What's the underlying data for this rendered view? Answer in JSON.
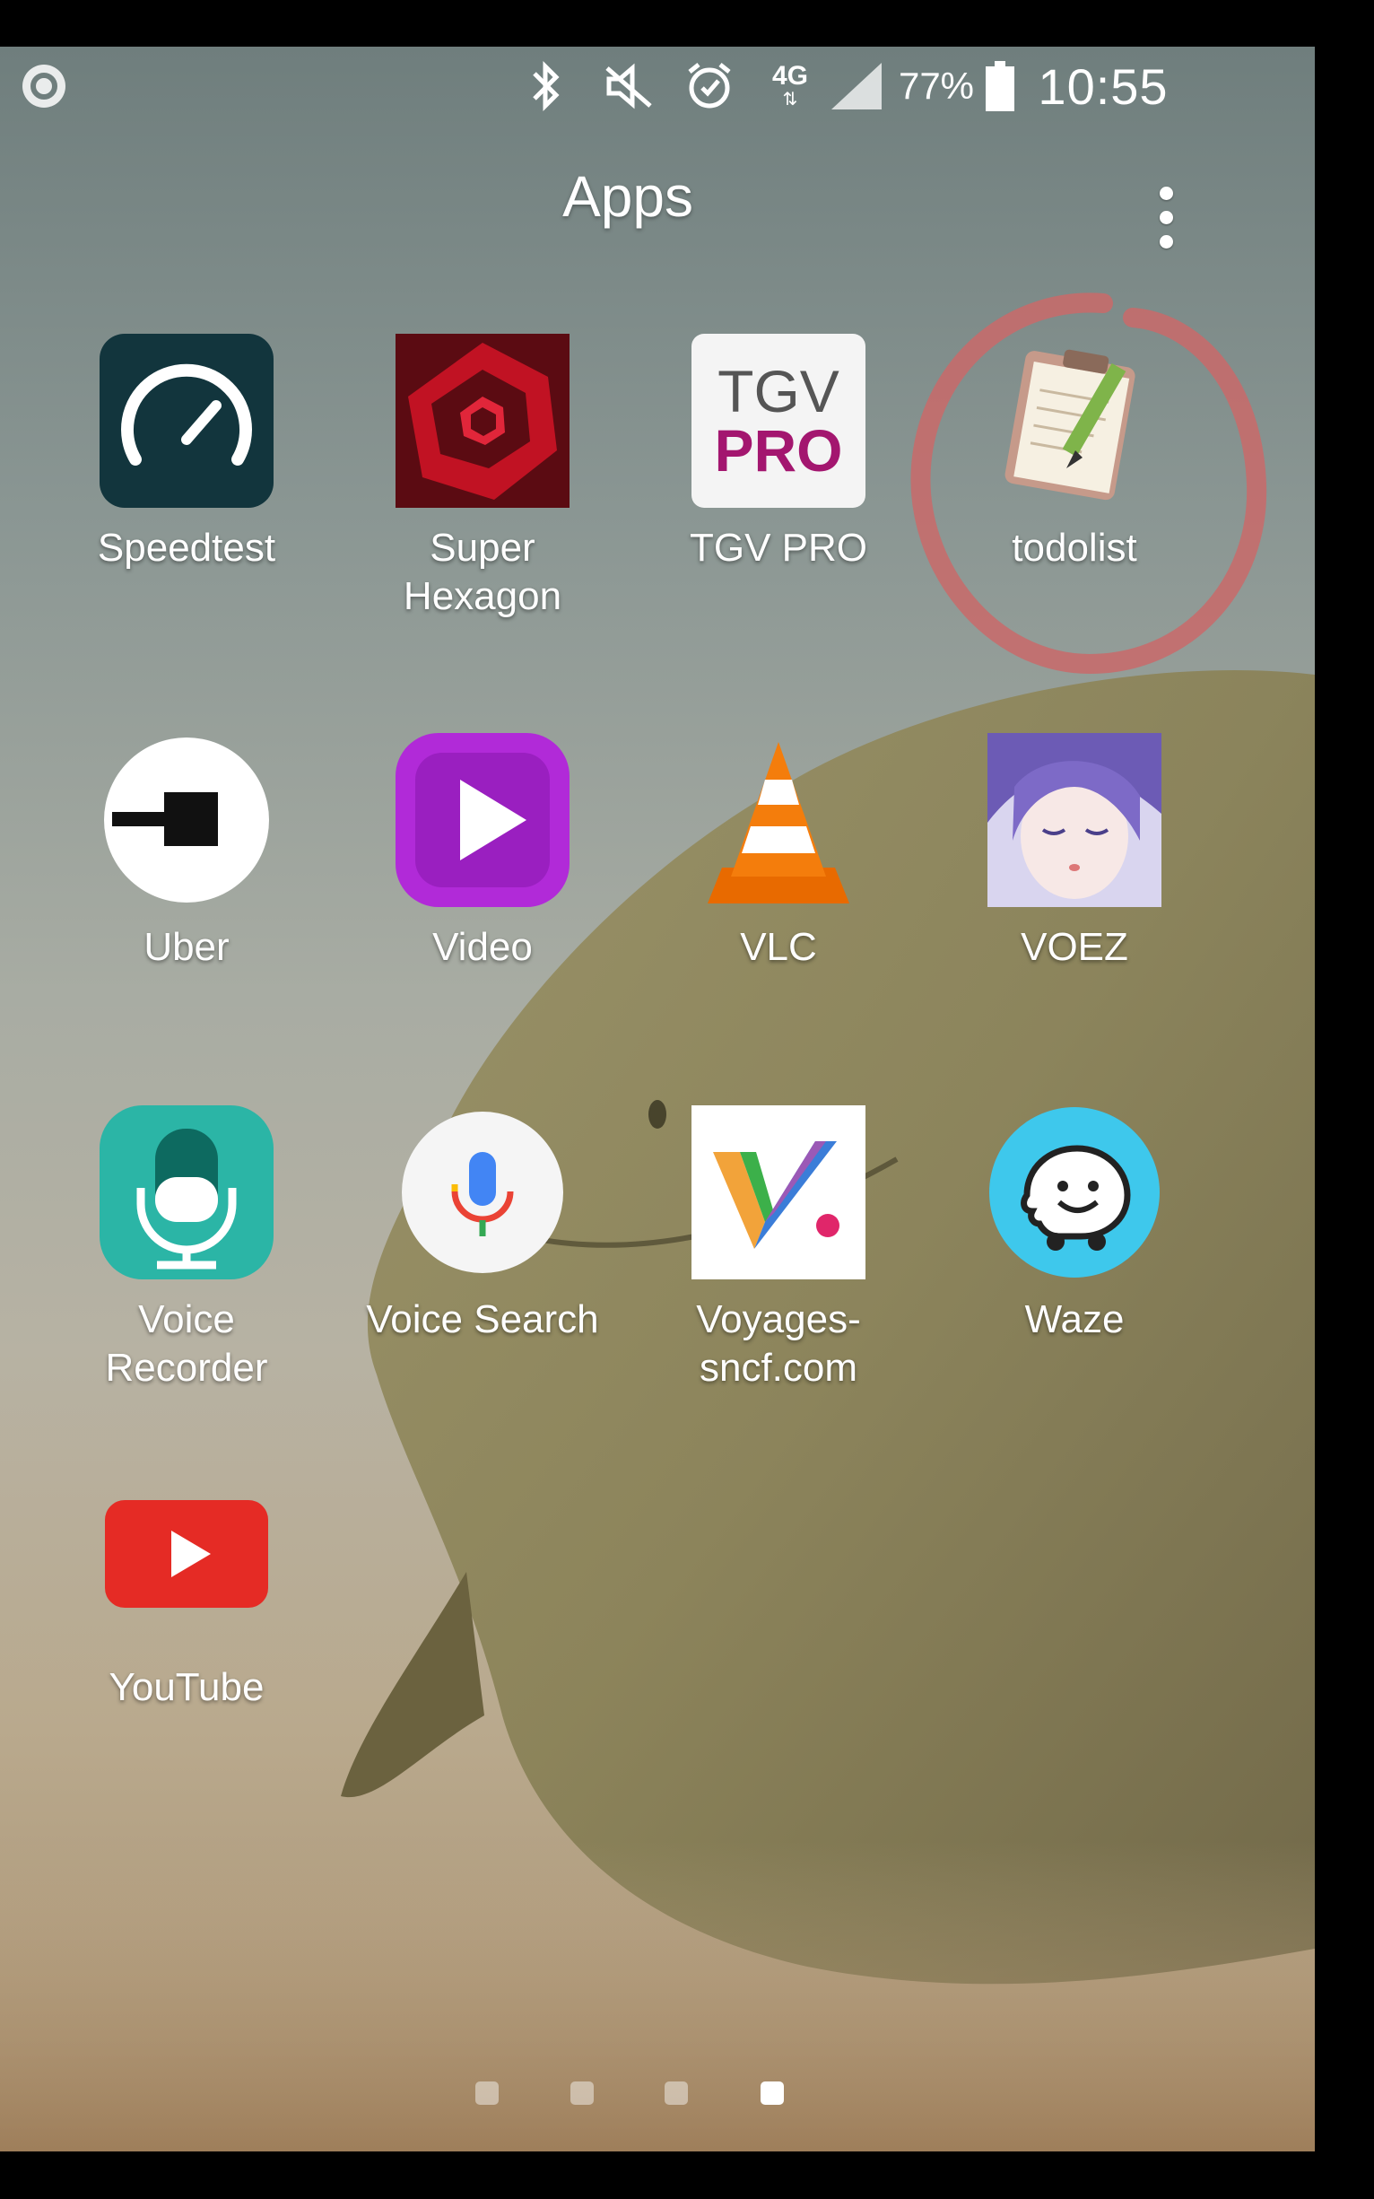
{
  "status_bar": {
    "time": "10:55",
    "battery_percent": "77%",
    "network": "4G",
    "icons": [
      "app-notification-icon",
      "bluetooth-icon",
      "mute-icon",
      "alarm-icon",
      "signal-icon",
      "battery-icon"
    ]
  },
  "header": {
    "title": "Apps",
    "more_icon": "more-vertical-icon"
  },
  "apps": [
    {
      "label": "Speedtest",
      "icon": "speedtest-icon"
    },
    {
      "label": "Super\nHexagon",
      "icon": "super-hexagon-icon"
    },
    {
      "label": "TGV PRO",
      "icon": "tgv-pro-icon",
      "icon_text_top": "TGV",
      "icon_text_bottom": "PRO"
    },
    {
      "label": "todolist",
      "icon": "todolist-icon",
      "highlighted": true
    },
    {
      "label": "Uber",
      "icon": "uber-icon"
    },
    {
      "label": "Video",
      "icon": "video-icon"
    },
    {
      "label": "VLC",
      "icon": "vlc-icon"
    },
    {
      "label": "VOEZ",
      "icon": "voez-icon"
    },
    {
      "label": "Voice\nRecorder",
      "icon": "voice-recorder-icon"
    },
    {
      "label": "Voice Search",
      "icon": "voice-search-icon"
    },
    {
      "label": "Voyages-\nsncf.com",
      "icon": "voyages-sncf-icon"
    },
    {
      "label": "Waze",
      "icon": "waze-icon"
    },
    {
      "label": "YouTube",
      "icon": "youtube-icon"
    }
  ],
  "page_indicator": {
    "page_count": 4,
    "active_page": 4
  },
  "colors": {
    "annotation_circle": "#c96a6a",
    "speedtest_bg": "#12353d",
    "super_hexagon_bg": "#c11223",
    "tgv_pro_magenta": "#a3166f",
    "video_purple": "#b12ad8",
    "vlc_orange": "#f47d0c",
    "voice_recorder_teal": "#2bb5a6",
    "waze_blue": "#3ec8ec",
    "youtube_red": "#e52b25"
  }
}
